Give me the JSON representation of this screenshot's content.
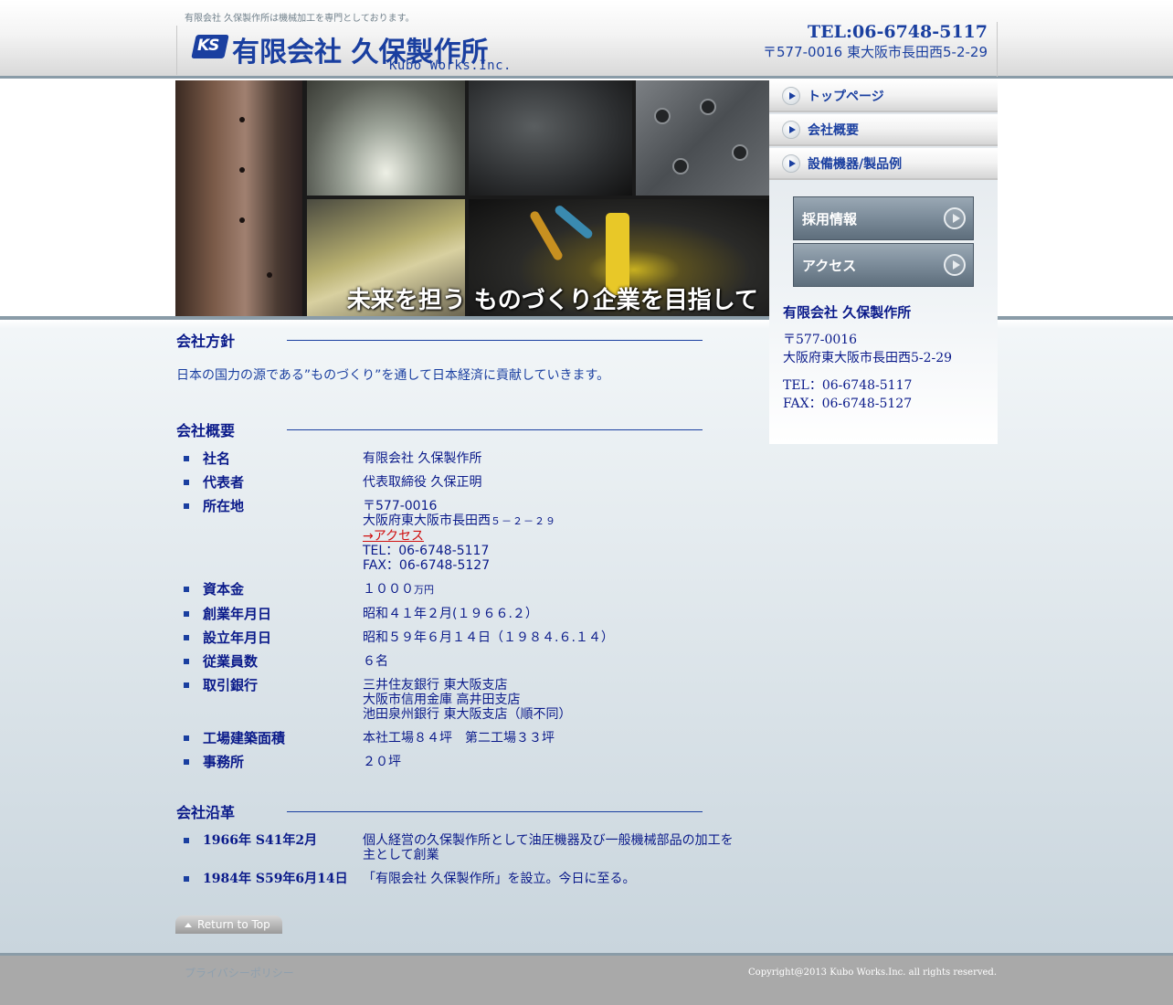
{
  "header": {
    "tagline": "有限会社 久保製作所は機械加工を専門としております。",
    "logo_mark": "KS",
    "logo_jp": "有限会社 久保製作所",
    "logo_en": "Kubo Works.Inc.",
    "tel": "TEL:06-6748-5117",
    "address": "〒577-0016 東大阪市長田西5-2-29"
  },
  "hero": {
    "caption": "未来を担う ものづくり企業を目指して"
  },
  "nav": {
    "items": [
      {
        "label": "トップページ"
      },
      {
        "label": "会社概要"
      },
      {
        "label": "設備機器/製品例"
      }
    ],
    "sub_buttons": [
      {
        "label": "採用情報"
      },
      {
        "label": "アクセス"
      }
    ]
  },
  "side_info": {
    "name": "有限会社 久保製作所",
    "postal": "〒577-0016",
    "address": "大阪府東大阪市長田西5-2-29",
    "tel": "TEL：06-6748-5117",
    "fax": "FAX：06-6748-5127"
  },
  "policy": {
    "title": "会社方針",
    "text": "日本の国力の源である”ものづくり”を通して日本経済に貢献していきます。"
  },
  "overview": {
    "title": "会社概要",
    "name_label": "社名",
    "name_value": "有限会社 久保製作所",
    "rep_label": "代表者",
    "rep_value": "代表取締役 久保正明",
    "loc_label": "所在地",
    "loc_postal": "〒577-0016",
    "loc_addr": "大阪府東大阪市長田西",
    "loc_addr_num": "５－２－２９",
    "loc_access": "→アクセス",
    "loc_tel": "TEL：06-6748-5117",
    "loc_fax": "FAX：06-6748-5127",
    "capital_label": "資本金",
    "capital_value": "１０００",
    "capital_unit": "万円",
    "found_label": "創業年月日",
    "found_value": "昭和４１年２月(１９６６.２）",
    "est_label": "設立年月日",
    "est_value": "昭和５９年６月１４日（１９８４.６.１４）",
    "emp_label": "従業員数",
    "emp_value": "６名",
    "bank_label": "取引銀行",
    "bank_1": "三井住友銀行 東大阪支店",
    "bank_2": "大阪市信用金庫 高井田支店",
    "bank_3": "池田泉州銀行 東大阪支店（順不同）",
    "factory_label": "工場建築面積",
    "factory_value": "本社工場８４坪　第二工場３３坪",
    "office_label": "事務所",
    "office_value": "２０坪"
  },
  "history": {
    "title": "会社沿革",
    "items": [
      {
        "date": "1966年 S41年2月",
        "text": "個人経営の久保製作所として油圧機器及び一般機械部品の加工を主として創業"
      },
      {
        "date": "1984年 S59年6月14日",
        "text": "「有限会社 久保製作所」を設立。今日に至る。"
      }
    ]
  },
  "return_top": "Return to Top",
  "footer": {
    "privacy": "プライバシーポリシー",
    "copyright": "Copyright@2013 Kubo Works.Inc. all rights reserved."
  }
}
